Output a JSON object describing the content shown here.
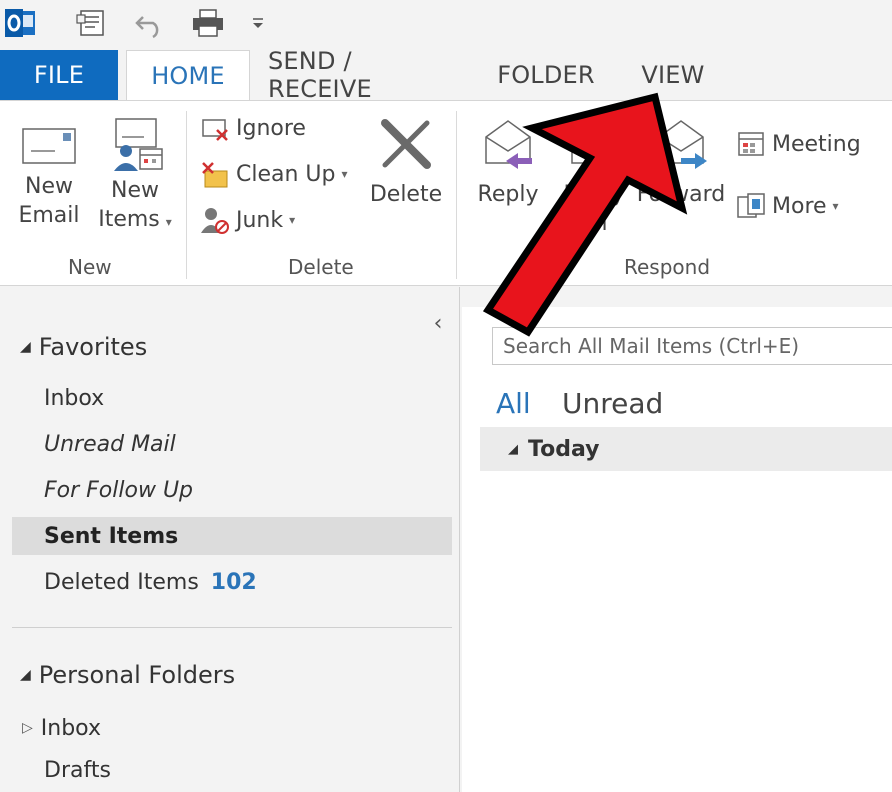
{
  "quick_access": {
    "buttons": [
      {
        "name": "outlook-logo",
        "icon": "outlook-icon"
      },
      {
        "name": "send-receive-all",
        "icon": "send-receive-icon"
      },
      {
        "name": "undo",
        "icon": "undo-icon"
      },
      {
        "name": "print",
        "icon": "printer-icon"
      },
      {
        "name": "customize",
        "icon": "dropdown-caret-icon"
      }
    ]
  },
  "tabs": {
    "file": "FILE",
    "home": "HOME",
    "send_receive": "SEND / RECEIVE",
    "folder": "FOLDER",
    "view": "VIEW"
  },
  "ribbon": {
    "new_group": {
      "label": "New",
      "new_email_line1": "New",
      "new_email_line2": "Email",
      "new_items_line1": "New",
      "new_items_line2": "Items"
    },
    "delete_group": {
      "label": "Delete",
      "ignore": "Ignore",
      "clean_up": "Clean Up",
      "junk": "Junk",
      "delete": "Delete"
    },
    "respond_group": {
      "label": "Respond",
      "reply": "Reply",
      "reply_all_line1": "Reply",
      "reply_all_line2": "All",
      "forward": "Forward",
      "meeting": "Meeting",
      "more": "More"
    }
  },
  "folder_pane": {
    "collapse_glyph": "‹",
    "favorites_header": "Favorites",
    "favorites": {
      "inbox": "Inbox",
      "unread_mail": "Unread Mail",
      "follow_up": "For Follow Up",
      "sent_items": "Sent Items",
      "deleted_items": "Deleted Items",
      "deleted_count": "102"
    },
    "personal_header": "Personal Folders",
    "personal": {
      "inbox": "Inbox",
      "drafts": "Drafts"
    }
  },
  "mail_list": {
    "search_placeholder": "Search All Mail Items (Ctrl+E)",
    "filter_all": "All",
    "filter_unread": "Unread",
    "group_today": "Today"
  },
  "colors": {
    "accent_blue": "#0f6bbf",
    "link_blue": "#2a74b8",
    "annotation_red": "#e8141c"
  }
}
